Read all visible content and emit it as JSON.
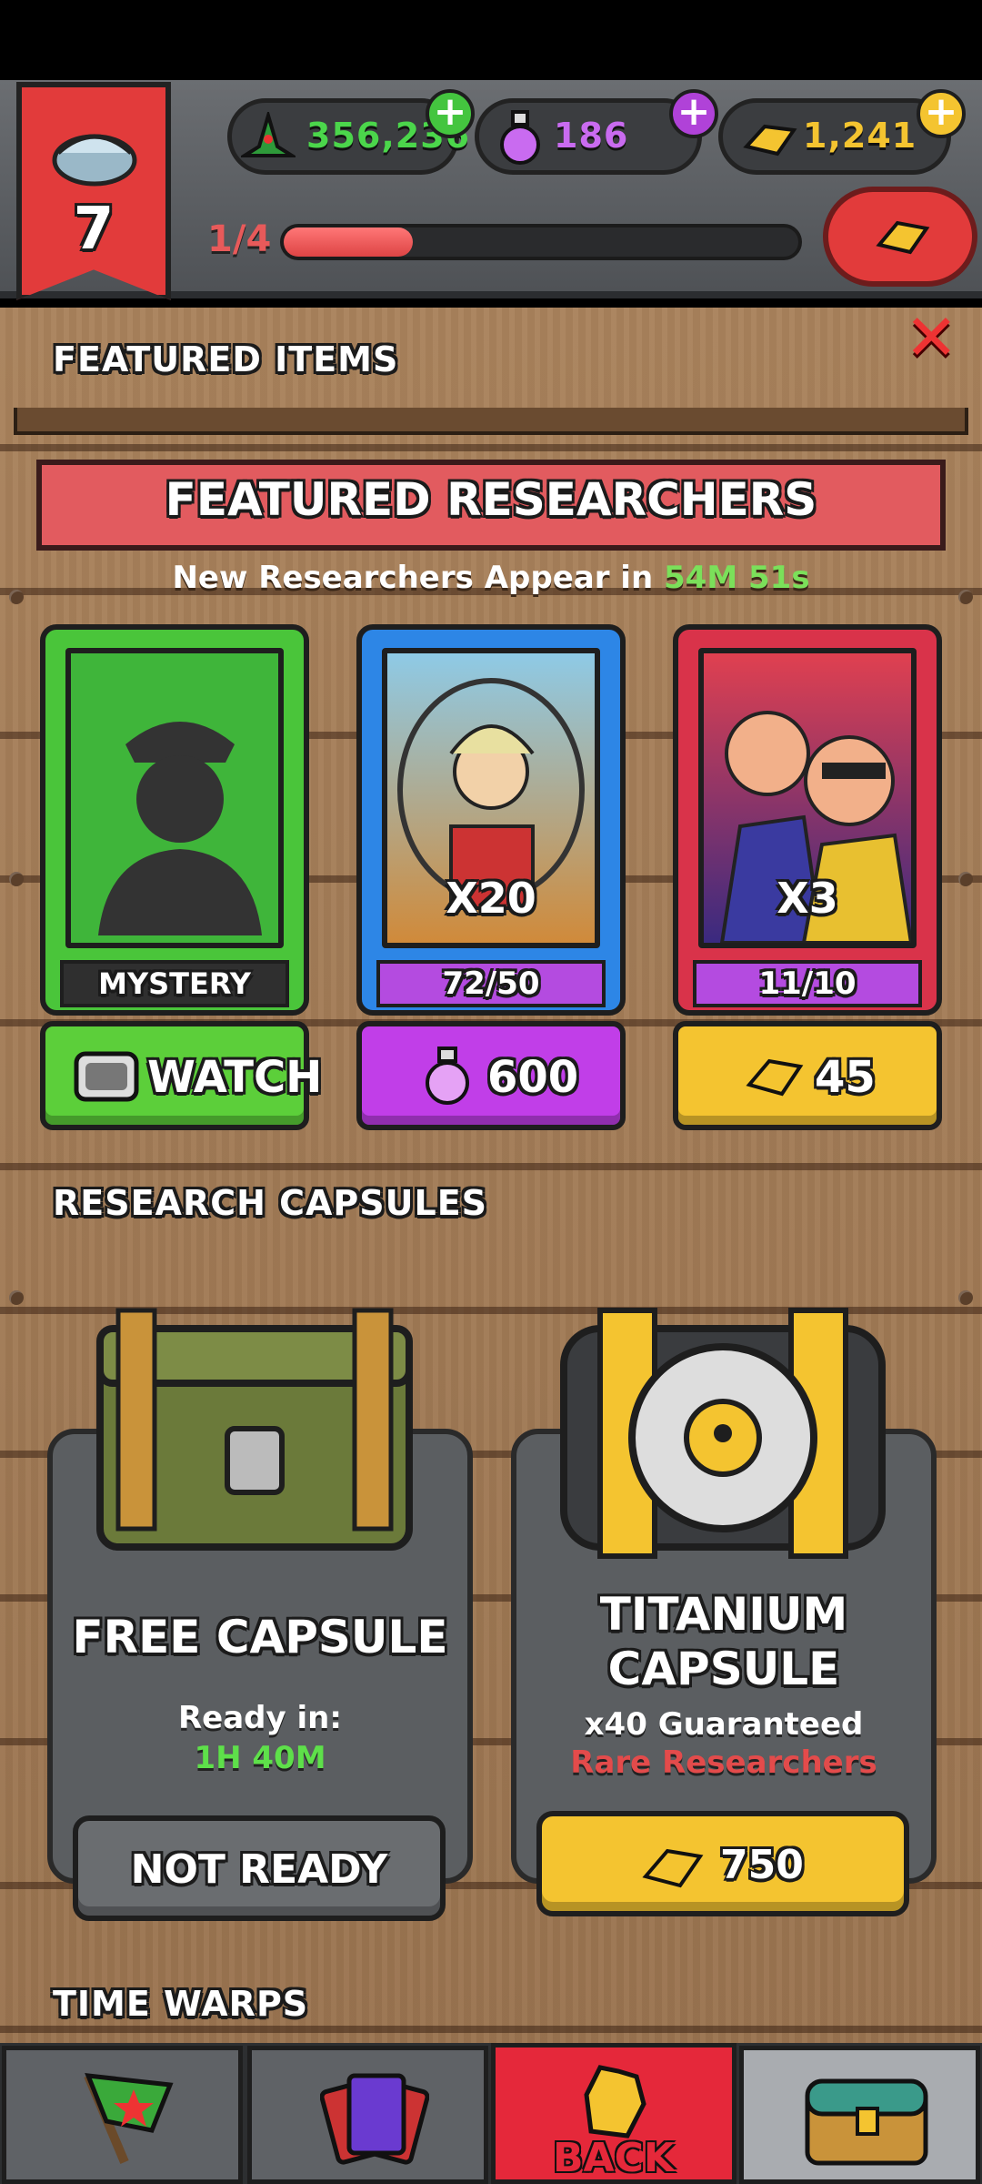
{
  "hud": {
    "level": "7",
    "currencies": [
      {
        "name": "cash",
        "value": "356,236",
        "color": "#4bd64b"
      },
      {
        "name": "potion",
        "value": "186",
        "color": "#c96bf0"
      },
      {
        "name": "gold",
        "value": "1,241",
        "color": "#f4c430"
      }
    ],
    "progress_text": "1/4",
    "progress_fraction": 0.25
  },
  "sections": {
    "featured_items": "FEATURED ITEMS",
    "research_capsules": "RESEARCH CAPSULES",
    "time_warps": "TIME WARPS"
  },
  "featured_researchers": {
    "title": "FEATURED RESEARCHERS",
    "timer_prefix": "New Researchers Appear in",
    "timer_value": "54M 51s",
    "cards": [
      {
        "label": "MYSTERY",
        "button": "WATCH",
        "frame_color": "#4ac53a",
        "button_color": "#5ccf3a"
      },
      {
        "label": "72/50",
        "multiplier": "X20",
        "button": "600",
        "frame_color": "#2d86e6",
        "button_color": "#c13ee8"
      },
      {
        "label": "11/10",
        "multiplier": "X3",
        "button": "45",
        "frame_color": "#d9334a",
        "button_color": "#f4c430"
      }
    ]
  },
  "capsules": [
    {
      "title": "FREE CAPSULE",
      "line1": "Ready in:",
      "line2": "1H 40M",
      "button": "NOT READY"
    },
    {
      "title_line1": "TITANIUM",
      "title_line2": "CAPSULE",
      "line1": "x40 Guaranteed",
      "line2": "Rare Researchers",
      "button": "750"
    }
  ],
  "nav": {
    "back_label": "BACK"
  }
}
